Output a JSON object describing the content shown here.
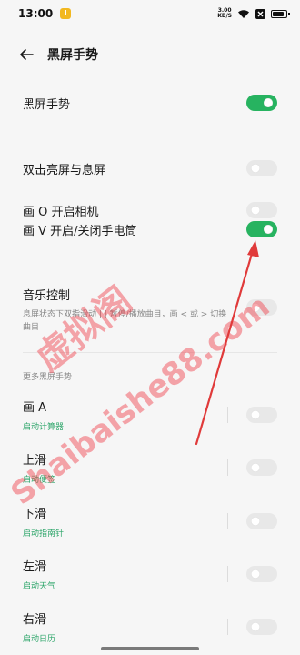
{
  "status_bar": {
    "time": "13:00",
    "net_speed_value": "3.00",
    "net_speed_unit": "KB/S"
  },
  "header": {
    "title": "黑屏手势"
  },
  "main_toggle": {
    "label": "黑屏手势",
    "on": true
  },
  "gestures": [
    {
      "label": "双击亮屏与息屏",
      "on": false
    },
    {
      "label": "画 O 开启相机",
      "on": false
    },
    {
      "label": "画 V 开启/关闭手电筒",
      "on": true
    },
    {
      "label": "音乐控制",
      "subtitle": "息屏状态下双指滑动 | | 暂停/播放曲目，画 < 或 > 切换曲目",
      "on": false
    }
  ],
  "more_section": {
    "title": "更多黑屏手势",
    "items": [
      {
        "label": "画 A",
        "subtitle": "启动计算器",
        "on": false
      },
      {
        "label": "上滑",
        "subtitle": "启动便签",
        "on": false
      },
      {
        "label": "下滑",
        "subtitle": "启动指南针",
        "on": false
      },
      {
        "label": "左滑",
        "subtitle": "启动天气",
        "on": false
      },
      {
        "label": "右滑",
        "subtitle": "启动日历",
        "on": false
      }
    ]
  },
  "watermark": {
    "line1": "虚拟阁",
    "line2": "Shaibaishe88.com"
  },
  "colors": {
    "accent_green": "#27b360",
    "subtitle_green": "#2fa66b",
    "annotation_red": "#e03a3a"
  }
}
